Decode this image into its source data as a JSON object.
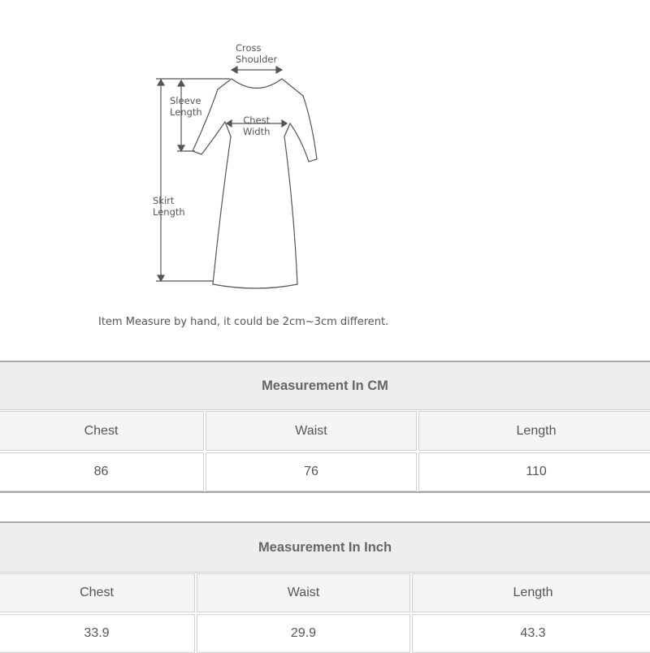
{
  "diagram": {
    "labels": {
      "cross_shoulder": "Cross\nShoulder",
      "sleeve_length": "Sleeve\nLength",
      "chest_width": "Chest\nWidth",
      "skirt_length": "Skirt\nLength"
    },
    "note": "Item Measure by hand, it could be 2cm~3cm different."
  },
  "tables": [
    {
      "title": "Measurement In CM",
      "headers": [
        "Chest",
        "Waist",
        "Length"
      ],
      "values": [
        "86",
        "76",
        "110"
      ]
    },
    {
      "title": "Measurement In Inch",
      "headers": [
        "Chest",
        "Waist",
        "Length"
      ],
      "values": [
        "33.9",
        "29.9",
        "43.3"
      ]
    }
  ]
}
